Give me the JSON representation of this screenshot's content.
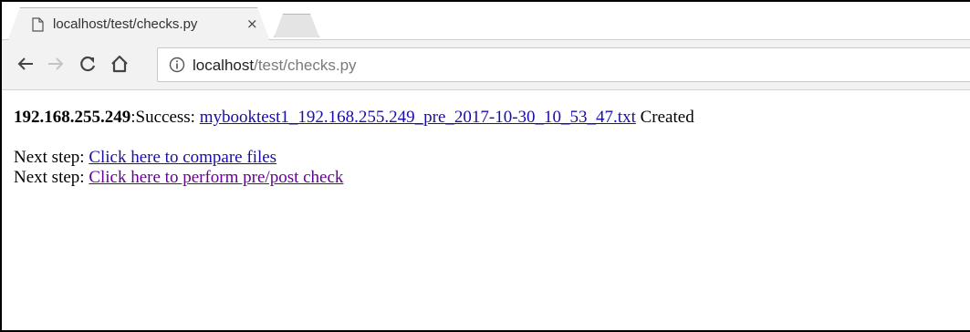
{
  "tab": {
    "title": "localhost/test/checks.py",
    "close_label": "×"
  },
  "toolbar": {
    "url_host": "localhost",
    "url_path": "/test/checks.py"
  },
  "page": {
    "ip": "192.168.255.249",
    "status_text": ":Success: ",
    "file_link": "mybooktest1_192.168.255.249_pre_2017-10-30_10_53_47.txt",
    "created_text": " Created",
    "steps": [
      {
        "prefix": "Next step: ",
        "link": "Click here to compare files "
      },
      {
        "prefix": "Next step: ",
        "link": "Click here to perform pre/post check"
      }
    ]
  },
  "colors": {
    "link": "#1a0dab",
    "visited_link": "#660099"
  },
  "icons": [
    "page-icon",
    "back-arrow-icon",
    "forward-arrow-icon",
    "reload-icon",
    "home-icon",
    "info-icon"
  ]
}
